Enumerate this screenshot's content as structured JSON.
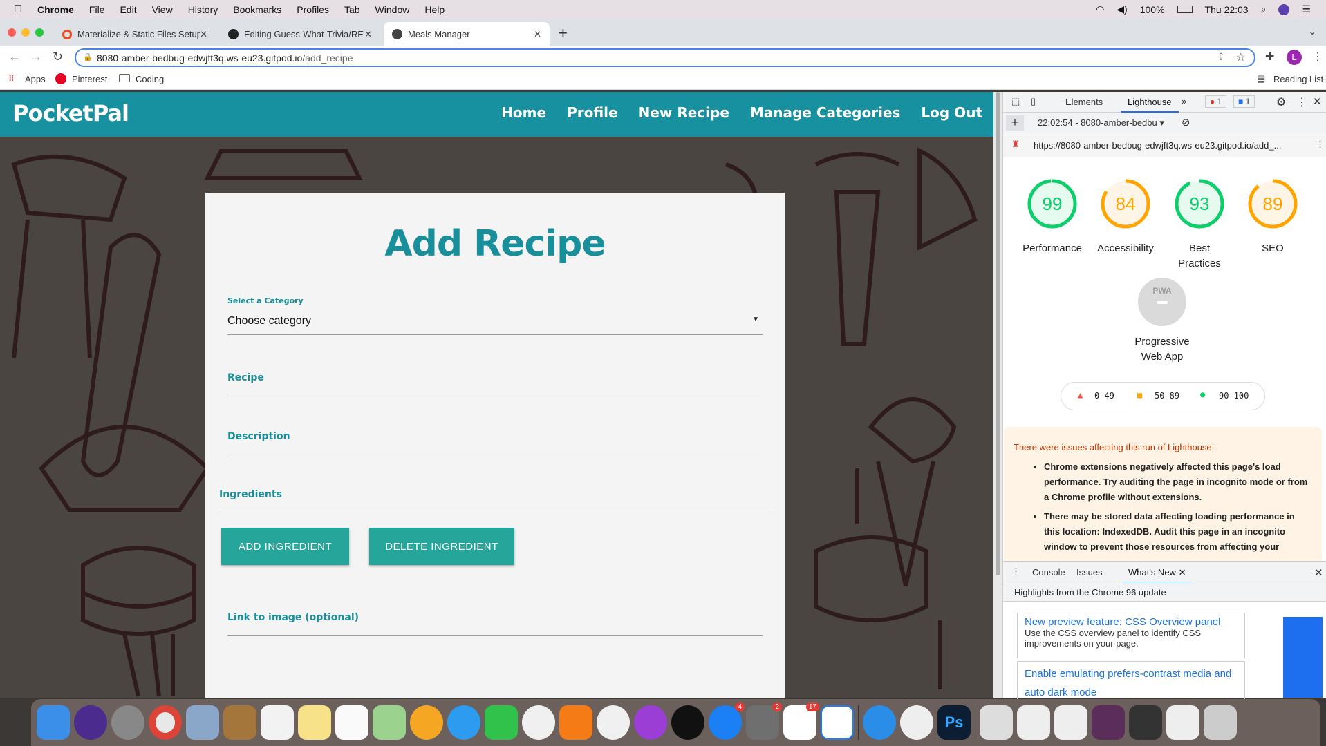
{
  "menubar": {
    "app": "Chrome",
    "items": [
      "File",
      "Edit",
      "View",
      "History",
      "Bookmarks",
      "Profiles",
      "Tab",
      "Window",
      "Help"
    ],
    "battery": "100%",
    "clock": "Thu 22:03"
  },
  "tabs": [
    {
      "title": "Materialize & Static Files Setup",
      "active": false
    },
    {
      "title": "Editing Guess-What-Trivia/README",
      "active": false
    },
    {
      "title": "Meals Manager",
      "active": true
    }
  ],
  "address": {
    "host": "8080-amber-bedbug-edwjft3q.ws-eu23.gitpod.io",
    "path": "/add_recipe"
  },
  "profile_initial": "L",
  "bookmarks": [
    "Apps",
    "Pinterest",
    "Coding"
  ],
  "reading_list": "Reading List",
  "site": {
    "brand": "PocketPal",
    "nav": [
      "Home",
      "Profile",
      "New Recipe",
      "Manage Categories",
      "Log Out"
    ],
    "title": "Add Recipe",
    "category_label": "Select a Category",
    "category_value": "Choose category",
    "recipe_label": "Recipe",
    "description_label": "Description",
    "ingredients_label": "Ingredients",
    "add_ingredient": "ADD INGREDIENT",
    "delete_ingredient": "DELETE INGREDIENT",
    "image_label": "Link to image (optional)",
    "colors": {
      "primary": "#17909f",
      "button": "#26a69a"
    }
  },
  "devtools": {
    "tabs": [
      "Elements",
      "Lighthouse"
    ],
    "active_tab": "Lighthouse",
    "error_count": "1",
    "message_count": "1",
    "report_select": "22:02:54 - 8080-amber-bedbu",
    "report_url": "https://8080-amber-bedbug-edwjft3q.ws-eu23.gitpod.io/add_...",
    "scores": [
      {
        "label": "Performance",
        "value": 99,
        "color": "#0cce6b"
      },
      {
        "label": "Accessibility",
        "value": 84,
        "color": "#ffa400"
      },
      {
        "label": "Best Practices",
        "value": 93,
        "color": "#0cce6b"
      },
      {
        "label": "SEO",
        "value": 89,
        "color": "#ffa400"
      }
    ],
    "pwa": {
      "badge": "PWA",
      "label1": "Progressive",
      "label2": "Web App"
    },
    "legend": [
      "0–49",
      "50–89",
      "90–100"
    ],
    "warning_title": "There were issues affecting this run of Lighthouse:",
    "warnings": [
      "Chrome extensions negatively affected this page's load performance. Try auditing the page in incognito mode or from a Chrome profile without extensions.",
      "There may be stored data affecting loading performance in this location: IndexedDB. Audit this page in an incognito window to prevent those resources from affecting your"
    ],
    "drawer_tabs": [
      "Console",
      "Issues",
      "What's New"
    ],
    "drawer_header": "Highlights from the Chrome 96 update",
    "news": [
      {
        "title": "New preview feature: CSS Overview panel",
        "body": "Use the CSS overview panel to identify CSS improvements on your page."
      },
      {
        "title": "Enable emulating prefers-contrast media and auto dark mode",
        "body": ""
      }
    ]
  },
  "dock": {
    "badges": {
      "app_store": "4",
      "system_prefs": "2",
      "slack": "17"
    }
  }
}
